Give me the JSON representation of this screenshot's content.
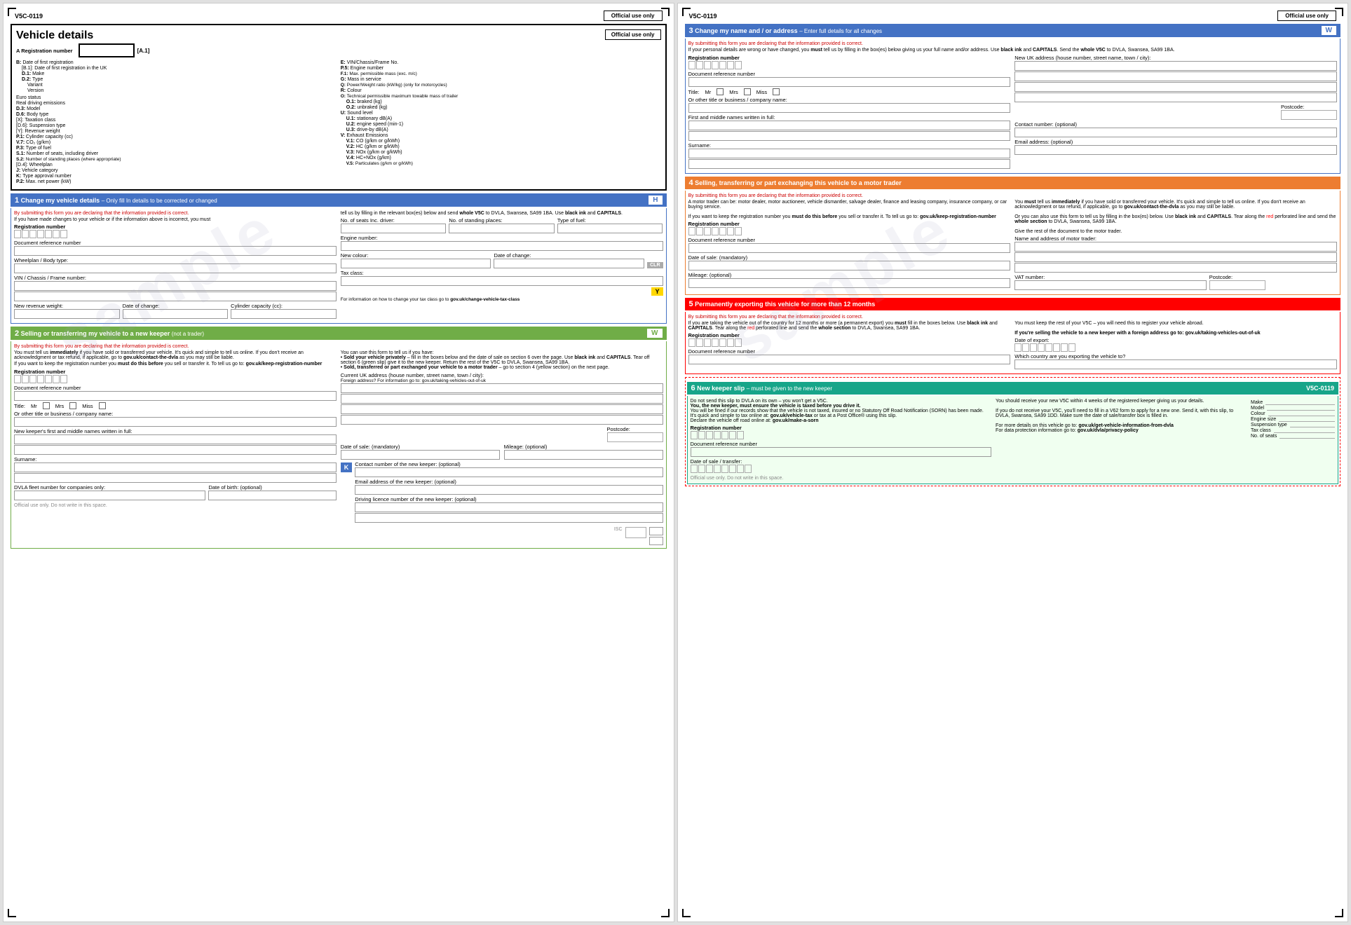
{
  "left_page": {
    "doc_code": "V5C-0119",
    "title": "Vehicle details",
    "official_use_only": "Official use only",
    "watermark": "sample",
    "sections": {
      "vehicle_info": {
        "a_label": "A Registration number",
        "a1_label": "[A.1]",
        "fields_col1": [
          "B: Date of first registration",
          "[B.1]: Date of first registration in the UK",
          "D.1: Make",
          "D.2: Type",
          "Variant",
          "Version",
          "",
          "Euro status",
          "Real driving emissions",
          "D.3: Model",
          "D.6: Body type",
          "[X]: Taxation class",
          "[D.6]: Suspension type",
          "[Y]: Revenue weight",
          "P.1: Cylinder capacity (cc)",
          "V.7: CO₂ (g/km)",
          "P.3: Type of fuel",
          "S.1: Number of seats, including driver",
          "S.2: Number of standing places (where appropriate)",
          "[D.4]: Wheelplan",
          "J: Vehicle category",
          "K: Type approval number",
          "P.2: Max. net power (kW)"
        ],
        "fields_col2": [
          "E: VIN/Chassis/Frame No.",
          "P.5: Engine number",
          "F.1: Max. permissible mass (exc. m/c)",
          "G: Mass in service",
          "Q: Power/Weight ratio (kW/kg) (only for motorcycles)",
          "R: Colour",
          "O: Technical permissible maximum towable mass of trailer",
          "O.1: braked (kg)",
          "O.2: unbraked (kg)",
          "U: Sound level",
          "U.1: stationary dB(A)",
          "U.2: engine speed (min-1)",
          "U.3: drive-by dB(A)",
          "V: Exhaust Emissions",
          "V.1: CO (g/km or g/kWh)",
          "V.2: HC (g/km or g/kWh)",
          "V.3: NOx (g/km or g/kWh)",
          "V.4: HC+NOx (g/km)",
          "V.5: Particulates (g/km or g/kWh)"
        ]
      },
      "section1": {
        "title": "1  Change my vehicle details",
        "subtitle": "– Only fill in details to be corrected or changed",
        "badge": "H",
        "badge_color": "#4472C4",
        "red_text": "By submitting this form you are declaring that the information provided is correct.",
        "body_text": "If you have made changes to your vehicle or if the information above is incorrect, you must",
        "body_text2": "tell us by filling in the relevant box(es) below and send whole V5C to DVLA, Swansea, SA99 1BA. Use black ink and CAPITALS.",
        "fields": [
          "Registration number",
          "Document reference number",
          "Wheelplan / Body type:",
          "VIN / Chassis / Frame number:",
          "New revenue weight:",
          "Date of change:",
          "Cylinder capacity (cc):"
        ],
        "right_fields": [
          "No. of seats Inc. driver:",
          "No. of standing places:",
          "Type of fuel:",
          "Engine number:",
          "New colour:",
          "Date of change:",
          "Tax class:"
        ],
        "clr_label": "CLR",
        "y_label": "Y",
        "info_text": "For information on how to change your tax class go to gov.uk/change-vehicle-tax-class"
      },
      "section2": {
        "title": "2  Selling or transferring my vehicle to a new keeper",
        "subtitle": "(not a trader)",
        "badge": "W",
        "badge_color": "#70AD47",
        "red_text": "By submitting this form you are declaring that the information provided is correct.",
        "body_text1": "You must tell us immediately if you have sold or transferred your vehicle. It's quick and simple to tell us online. If you don't receive an acknowledgment or tax refund, if applicable, go to gov.uk/contact-the-dvla as you may still be liable.",
        "body_text2": "If you want to keep the registration number you must do this before you sell or transfer it. To tell us go to: gov.uk/keep-registration-number",
        "right_text": "You can use this form to tell us if you have:\n• Sold your vehicle privately – fill in the boxes below and the date of sale on section 6 over the page. Use black ink and CAPITALS. Tear off section 6 (green slip) give it to the new keeper. Return the rest of the V5C to DVLA, Swansea, SA99 1BA.\n• Sold, transferred or part exchanged your vehicle to a motor trader – go to section 4 (yellow section) on the next page.",
        "fields": [
          "Registration number",
          "Document reference number"
        ],
        "title_label": "Title:",
        "mr_label": "Mr",
        "mrs_label": "Mrs",
        "miss_label": "Miss",
        "company_label": "Or other title or business / company name:",
        "names_label": "New keeper's first and middle names written in full:",
        "surname_label": "Surname:",
        "dvla_fleet_label": "DVLA fleet number for companies only:",
        "dob_label": "Date of birth: (optional)",
        "address_label": "Current UK address (house number, street name, town / city):",
        "foreign_label": "Foreign address? For information go to: gov.uk/taking-vehicles-out-of-uk",
        "postcode_label": "Postcode:",
        "date_of_sale_label": "Date of sale: (mandatory)",
        "mileage_label": "Mileage: (optional)",
        "k_label": "K",
        "contact_label": "Contact number of the new keeper: (optional)",
        "email_label": "Email address of the new keeper: (optional)",
        "driving_licence_label": "Driving licence number of the new keeper: (optional)",
        "official_use_label": "Official use only. Do not write in this space.",
        "isc_label": "ISC"
      }
    }
  },
  "right_page": {
    "doc_code": "V5C-0119",
    "official_use_only": "Official use only",
    "watermark": "sample",
    "sections": {
      "section3": {
        "title": "3  Change my name and / or address",
        "subtitle": "– Enter full details for all changes",
        "badge": "W",
        "badge_color": "#4472C4",
        "red_text": "By submitting this form you are declaring that the information provided is correct.",
        "body_text": "If your personal details are wrong or have changed, you must tell us by filling in the box(es) below giving us your full name and/or address. Use black ink and CAPITALS. Send the whole V5C to DVLA, Swansea, SA99 1BA.",
        "fields": [
          "Registration number",
          "Document reference number"
        ],
        "title_label": "Title:",
        "mr_label": "Mr",
        "mrs_label": "Mrs",
        "miss_label": "Miss",
        "company_label": "Or other title or business / company name:",
        "names_label": "First and middle names written in full:",
        "surname_label": "Surname:",
        "new_uk_address_label": "New UK address (house number, street name, town / city):",
        "postcode_label": "Postcode:",
        "contact_label": "Contact number: (optional)",
        "email_label": "Email address: (optional)"
      },
      "section4": {
        "title": "4  Selling, transferring or part exchanging this vehicle to a motor trader",
        "red_text": "By submitting this form you are declaring that the information provided is correct.",
        "body_text_left": "A motor trader can be: motor dealer, motor auctioneer, vehicle dismantler, salvage dealer, finance and leasing company, insurance company, or car buying service.\nIf you want to keep the registration number you must do this before you sell or transfer it. To tell us go to: gov.uk/keep-registration-number",
        "body_text_right": "You must tell us immediately if you have sold or transferred your vehicle. It's quick and simple to tell us online. If you don't receive an acknowledgment or tax refund, if applicable, go to gov.uk/contact-the-dvla as you may still be liable.\nOr you can also use this form to tell us by filling in the box(es) below. Use black ink and CAPITALS. Tear along the red perforated line and send the whole section to DVLA, Swansea, SA99 1BA.\nGive the rest of the document to the motor trader.",
        "fields_left": [
          "Registration number",
          "Document reference number",
          "Date of sale: (mandatory)",
          "Mileage: (optional)"
        ],
        "fields_right": [
          "Name and address of motor trader:",
          "VAT number:",
          "Postcode:"
        ]
      },
      "section5": {
        "title": "5  Permanently exporting this vehicle for more than 12 months",
        "red_text": "By submitting this form you are declaring that the information provided is correct.",
        "body_text_left": "If you are taking the vehicle out of the country for 12 months or more (a permanent export) you must fill in the boxes below. Use black ink and CAPITALS. Tear along the red perforated line and send the whole section to DVLA, Swansea, SA99 1BA.",
        "body_text_right": "You must keep the rest of your V5C – you will need this to register your vehicle abroad.\nIf you're selling the vehicle to a new keeper with a foreign address go to: gov.uk/taking-vehicles-out-of-uk",
        "fields": [
          "Registration number",
          "Document reference number",
          "Date of export:",
          "Which country are you exporting the vehicle to?"
        ]
      },
      "section6": {
        "title": "6  New keeper slip",
        "subtitle": "– must be given to the new keeper",
        "doc_code": "V5C-0119",
        "body_left": "Do not send this slip to DVLA on its own – you won't get a V5C.\nYou, the new keeper, must ensure the vehicle is taxed before you drive it.\nYou will be fined if our records show that the vehicle is not taxed, insured or no Statutory Off Road Notification (SORN) has been made.\nIt's quick and simple to tax online at: gov.uk/vehicle-tax or tax at a Post Office® using this slip.\nDeclare the vehicle off road online at: gov.uk/make-a-sorn",
        "body_right": "You should receive your new V5C within 4 weeks of the registered keeper giving us your details.\nIf you do not receive your V5C, you'll need to fill in a V62 form to apply for a new one. Send it, with this slip, to DVLA, Swansea, SA99 1DD. Make sure the date of sale/transfer box is filled in.\nFor more details on this vehicle go to: gov.uk/get-vehicle-information-from-dvla\nFor data protection information go to: gov.uk/dvla/privacy-policy",
        "fields": [
          "Registration number",
          "Document reference number",
          "Date of sale / transfer:"
        ],
        "vehicle_details": [
          "Make",
          "Model",
          "Colour",
          "Engine size",
          "Suspension type",
          "Tax class",
          "No. of seats"
        ],
        "official_use_label": "Official use only. Do not write in this space."
      }
    }
  }
}
